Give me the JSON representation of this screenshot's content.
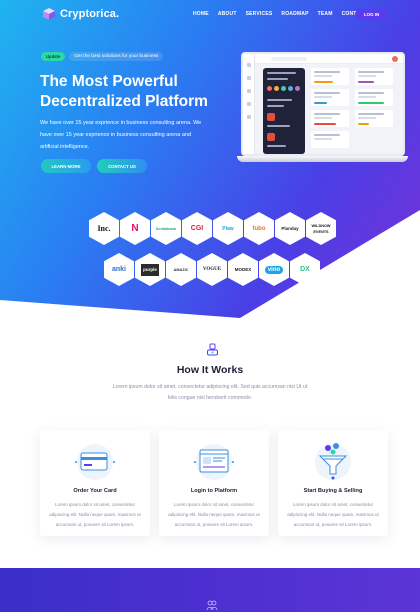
{
  "brand": {
    "name": "Cryptorica."
  },
  "nav": {
    "items": [
      "HOME",
      "ABOUT",
      "SERVICES",
      "ROADMAP",
      "TEAM",
      "CONTACT"
    ],
    "login_label": "LOG IN"
  },
  "hero": {
    "badge": "Update",
    "badge_text": "Get the best solutions for your business",
    "title_line1": "The Most Powerful",
    "title_line2": "Decentralized Platform",
    "description": "We have over 15 year exprience in business consulting arena. We have over 15 year exprience in business consulting arena and artificial intelligence.",
    "learn_more": "LEARN MORE",
    "contact_us": "CONTACT US"
  },
  "partners": {
    "row1": [
      "Inc.",
      "N",
      "Scotiabank",
      "CGI",
      "Plaw",
      "fubo",
      "Planday",
      "WILDNOW EVENTS"
    ],
    "row2": [
      "anki",
      "purple",
      "AMAZIC",
      "VOGUE",
      "MODEX",
      "vino",
      "DX"
    ]
  },
  "how": {
    "title": "How It Works",
    "description": "Lorem ipsum dolor sit amet, consectetur adipiscing elit. Sed quis accumsan nisi Ut ut felis congue nisl hendrerit commodo.",
    "cards": [
      {
        "title": "Order Your Card",
        "text": "Lorem ipsum dolor sit amet, consectetur adipiscing elit. Nulla neque quam, maximus ut accumsan ut, posuere sit Lorem ipsum."
      },
      {
        "title": "Login to Platform",
        "text": "Lorem ipsum dolor sit amet, consectetur adipiscing elit. Nulla neque quam, maximus ut accumsan ut, posuere sit Lorem ipsum."
      },
      {
        "title": "Start Buying & Selling",
        "text": "Lorem ipsum dolor sit amet, consectetur adipiscing elit. Nulla neque quam, maximus ut accumsan ut, posuere sit Lorem ipsum."
      }
    ]
  },
  "colors": {
    "hero_start": "#1fb4f0",
    "hero_end": "#7a2fd6",
    "accent": "#5b3bf0",
    "badge": "#2bd9a5",
    "footer_band": "#4d2fd0"
  },
  "icons": [
    "logo-cube-icon",
    "how-it-works-icon",
    "credit-card-icon",
    "browser-window-icon",
    "funnel-coins-icon",
    "team-icon"
  ]
}
